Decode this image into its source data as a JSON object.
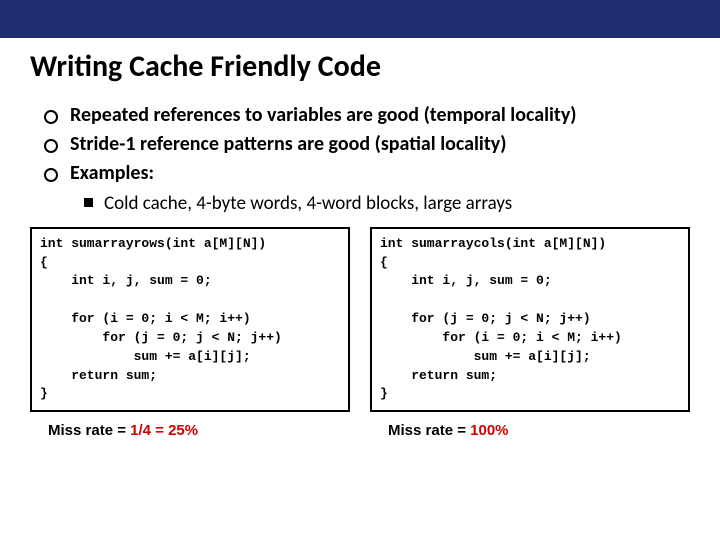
{
  "title": "Writing Cache Friendly Code",
  "bullets": [
    "Repeated references to variables are good (temporal locality)",
    "Stride-1 reference patterns are good (spatial locality)",
    "Examples:"
  ],
  "sub": [
    "Cold cache, 4-byte words, 4-word blocks, large arrays"
  ],
  "left": {
    "code": "int sumarrayrows(int a[M][N])\n{\n    int i, j, sum = 0;\n\n    for (i = 0; i < M; i++)\n        for (j = 0; j < N; j++)\n            sum += a[i][j];\n    return sum;\n}",
    "miss_label": "Miss rate = ",
    "miss_value": "1/4 = 25%"
  },
  "right": {
    "code": "int sumarraycols(int a[M][N])\n{\n    int i, j, sum = 0;\n\n    for (j = 0; j < N; j++)\n        for (i = 0; i < M; i++)\n            sum += a[i][j];\n    return sum;\n}",
    "miss_label": "Miss rate = ",
    "miss_value": "100%"
  }
}
